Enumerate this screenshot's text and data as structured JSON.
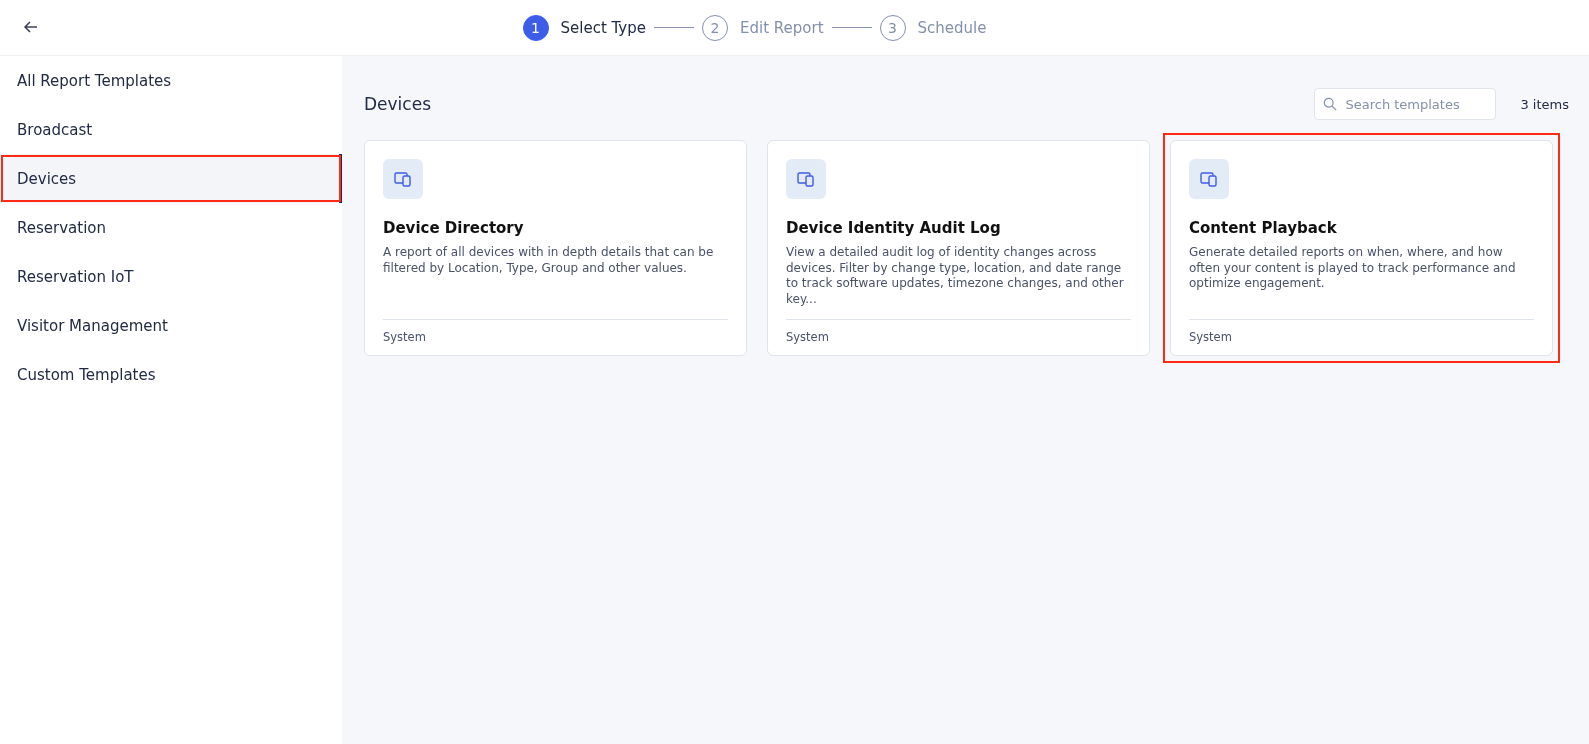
{
  "steps": [
    {
      "number": "1",
      "label": "Select Type",
      "selected": true
    },
    {
      "number": "2",
      "label": "Edit Report",
      "selected": false
    },
    {
      "number": "3",
      "label": "Schedule",
      "selected": false
    }
  ],
  "sidebar": {
    "items": [
      {
        "label": "All Report Templates",
        "selected": false,
        "highlighted": false
      },
      {
        "label": "Broadcast",
        "selected": false,
        "highlighted": false
      },
      {
        "label": "Devices",
        "selected": true,
        "highlighted": true
      },
      {
        "label": "Reservation",
        "selected": false,
        "highlighted": false
      },
      {
        "label": "Reservation IoT",
        "selected": false,
        "highlighted": false
      },
      {
        "label": "Visitor Management",
        "selected": false,
        "highlighted": false
      },
      {
        "label": "Custom Templates",
        "selected": false,
        "highlighted": false
      }
    ]
  },
  "main": {
    "title": "Devices",
    "search": {
      "placeholder": "Search templates"
    },
    "count": "3 items",
    "cards": [
      {
        "title": "Device Directory",
        "description": "A report of all devices with in depth details that can be filtered by Location, Type, Group and other values.",
        "footer": "System",
        "highlighted": false
      },
      {
        "title": "Device Identity Audit Log",
        "description": "View a detailed audit log of identity changes across devices. Filter by change type, location, and date range to track software updates, timezone changes, and other key...",
        "footer": "System",
        "highlighted": false
      },
      {
        "title": "Content Playback",
        "description": "Generate detailed reports on when, where, and how often your content is played to track performance and optimize engagement.",
        "footer": "System",
        "highlighted": true
      }
    ]
  }
}
